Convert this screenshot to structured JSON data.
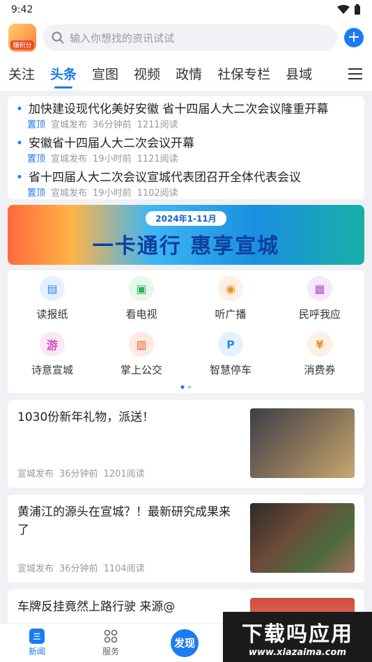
{
  "status": {
    "time": "9:42"
  },
  "search": {
    "placeholder": "输入你想找的资讯试试",
    "logo_badge": "赚积分"
  },
  "tabs": [
    "关注",
    "头条",
    "宣图",
    "视频",
    "政情",
    "社保专栏",
    "县域"
  ],
  "headlines": [
    {
      "title": "加快建设现代化美好安徽  省十四届人大二次会议隆重开幕",
      "pin": "置顶",
      "source": "宣城发布",
      "time": "36分钟前",
      "reads": "1211阅读"
    },
    {
      "title": "安徽省十四届人大二次会议开幕",
      "pin": "置顶",
      "source": "宣城发布",
      "time": "19小时前",
      "reads": "1121阅读"
    },
    {
      "title": "省十四届人大二次会议宣城代表团召开全体代表会议",
      "pin": "置顶",
      "source": "宣城发布",
      "time": "19小时前",
      "reads": "1102阅读"
    }
  ],
  "banner": {
    "date": "2024年1-11月",
    "slogan": "一卡通行  惠享宣城"
  },
  "services": [
    {
      "label": "读报纸",
      "icon": "newspaper-icon",
      "color": "#2b8cf0",
      "bg": "#e6f1fe",
      "glyph": "▤"
    },
    {
      "label": "看电视",
      "icon": "tv-icon",
      "color": "#2cb45b",
      "bg": "#e6f7ec",
      "glyph": "▣"
    },
    {
      "label": "听广播",
      "icon": "radio-icon",
      "color": "#f08a2b",
      "bg": "#fef0e3",
      "glyph": "◉"
    },
    {
      "label": "民呼我应",
      "icon": "chat-icon",
      "color": "#b04fd6",
      "bg": "#f5e8fb",
      "glyph": "▦"
    },
    {
      "label": "诗意宣城",
      "icon": "travel-icon",
      "color": "#d64fb8",
      "bg": "#fbe8f6",
      "glyph": "游"
    },
    {
      "label": "掌上公交",
      "icon": "bus-icon",
      "color": "#f05a2b",
      "bg": "#feeae3",
      "glyph": "▥"
    },
    {
      "label": "智慧停车",
      "icon": "parking-icon",
      "color": "#2b8cf0",
      "bg": "#e6f1fe",
      "glyph": "P"
    },
    {
      "label": "消费券",
      "icon": "coupon-icon",
      "color": "#f08a2b",
      "bg": "#fef0e3",
      "glyph": "¥"
    }
  ],
  "cards": [
    {
      "title": "1030份新年礼物，派送！",
      "source": "宣城发布",
      "time": "36分钟前",
      "reads": "1201阅读"
    },
    {
      "title": "黄浦江的源头在宣城？！最新研究成果来了",
      "source": "宣城发布",
      "time": "36分钟前",
      "reads": "1104阅读"
    },
    {
      "title": "车牌反挂竟然上路行驶  来源@",
      "source": "",
      "time": "",
      "reads": ""
    }
  ],
  "bottom_nav": {
    "news": "新闻",
    "news_icon": "三",
    "services": "服务",
    "discover": "发现"
  },
  "watermark": {
    "line1": "下载吗应用",
    "line2": "www.xiazaima.com"
  }
}
